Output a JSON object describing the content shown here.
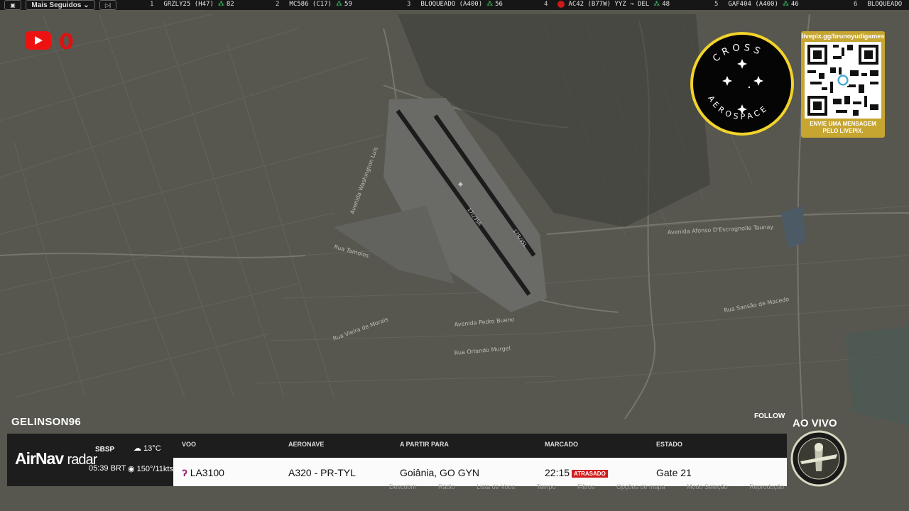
{
  "topbar": {
    "filter_label": "Mais Seguidos ⌄",
    "items": [
      {
        "rank": "1",
        "flight": "GRZLY25 (H47)",
        "count": "82",
        "dot": "#0000"
      },
      {
        "rank": "2",
        "flight": "MC586 (C17)",
        "count": "59",
        "dot": "#2c5d9c"
      },
      {
        "rank": "3",
        "flight": "BLOQUEADO (A400)",
        "count": "56",
        "dot": "#0000"
      },
      {
        "rank": "4",
        "flight": "AC42 (B77W) YYZ → DEL",
        "count": "48",
        "dot": "#c71a1a"
      },
      {
        "rank": "5",
        "flight": "GAF404 (A400)",
        "count": "46",
        "dot": "#888888"
      },
      {
        "rank": "6",
        "flight": "BLOQUEADO",
        "count": "",
        "dot": "#0000"
      }
    ]
  },
  "overlay": {
    "youtube_count": "0",
    "cross_top": "CROSS",
    "cross_bottom": "AEROSPACE",
    "qr_url": "livepix.gg/brunoyudigames",
    "qr_msg_1": "ENVIE UMA MENSAGEM",
    "qr_msg_2": "PELO LIVEPIX."
  },
  "map_labels": {
    "runway_a": "17L/35R",
    "runway_b": "17R/35L",
    "streets": [
      "Avenida Washington Luís",
      "Rua Tamoios",
      "Avenida Pedro Bueno",
      "Rua Orlando Murgel",
      "Avenida Afonso D'Escragnolle Taunay",
      "Rua Vieira de Morais",
      "Rua Sansão de Macedo"
    ]
  },
  "panel": {
    "username": "GELINSON96",
    "follow": "FOLLOW",
    "live": "AO VIVO",
    "brand_a": "AirNav",
    "brand_b": "radar",
    "airport": "SBSP",
    "time": "05:39 BRT",
    "temp": "13°C",
    "wind": "150°/11kts",
    "headers": {
      "flight": "VOO",
      "aircraft": "AERONAVE",
      "route": "A PARTIR PARA",
      "scheduled": "MARCADO",
      "status": "ESTADO"
    },
    "row": {
      "flight": "LA3100",
      "aircraft": "A320 - PR-TYL",
      "route": "Goiânia, GO GYN",
      "scheduled": "22:15",
      "delayed": "ATRASADO",
      "status": "Gate 21"
    },
    "menu": [
      "Descobrir",
      "Rádio",
      "Lista de Voos",
      "Tempo",
      "Filtros",
      "Opções de mapa",
      "Modo Seleção",
      "Reprodução"
    ]
  },
  "colors": {
    "map_bg": "#55554f",
    "panel_bg": "#1d1d1d",
    "delayed": "#d21d1d",
    "qr_gold": "#c6a530",
    "logo_ring": "#f1d32a"
  }
}
